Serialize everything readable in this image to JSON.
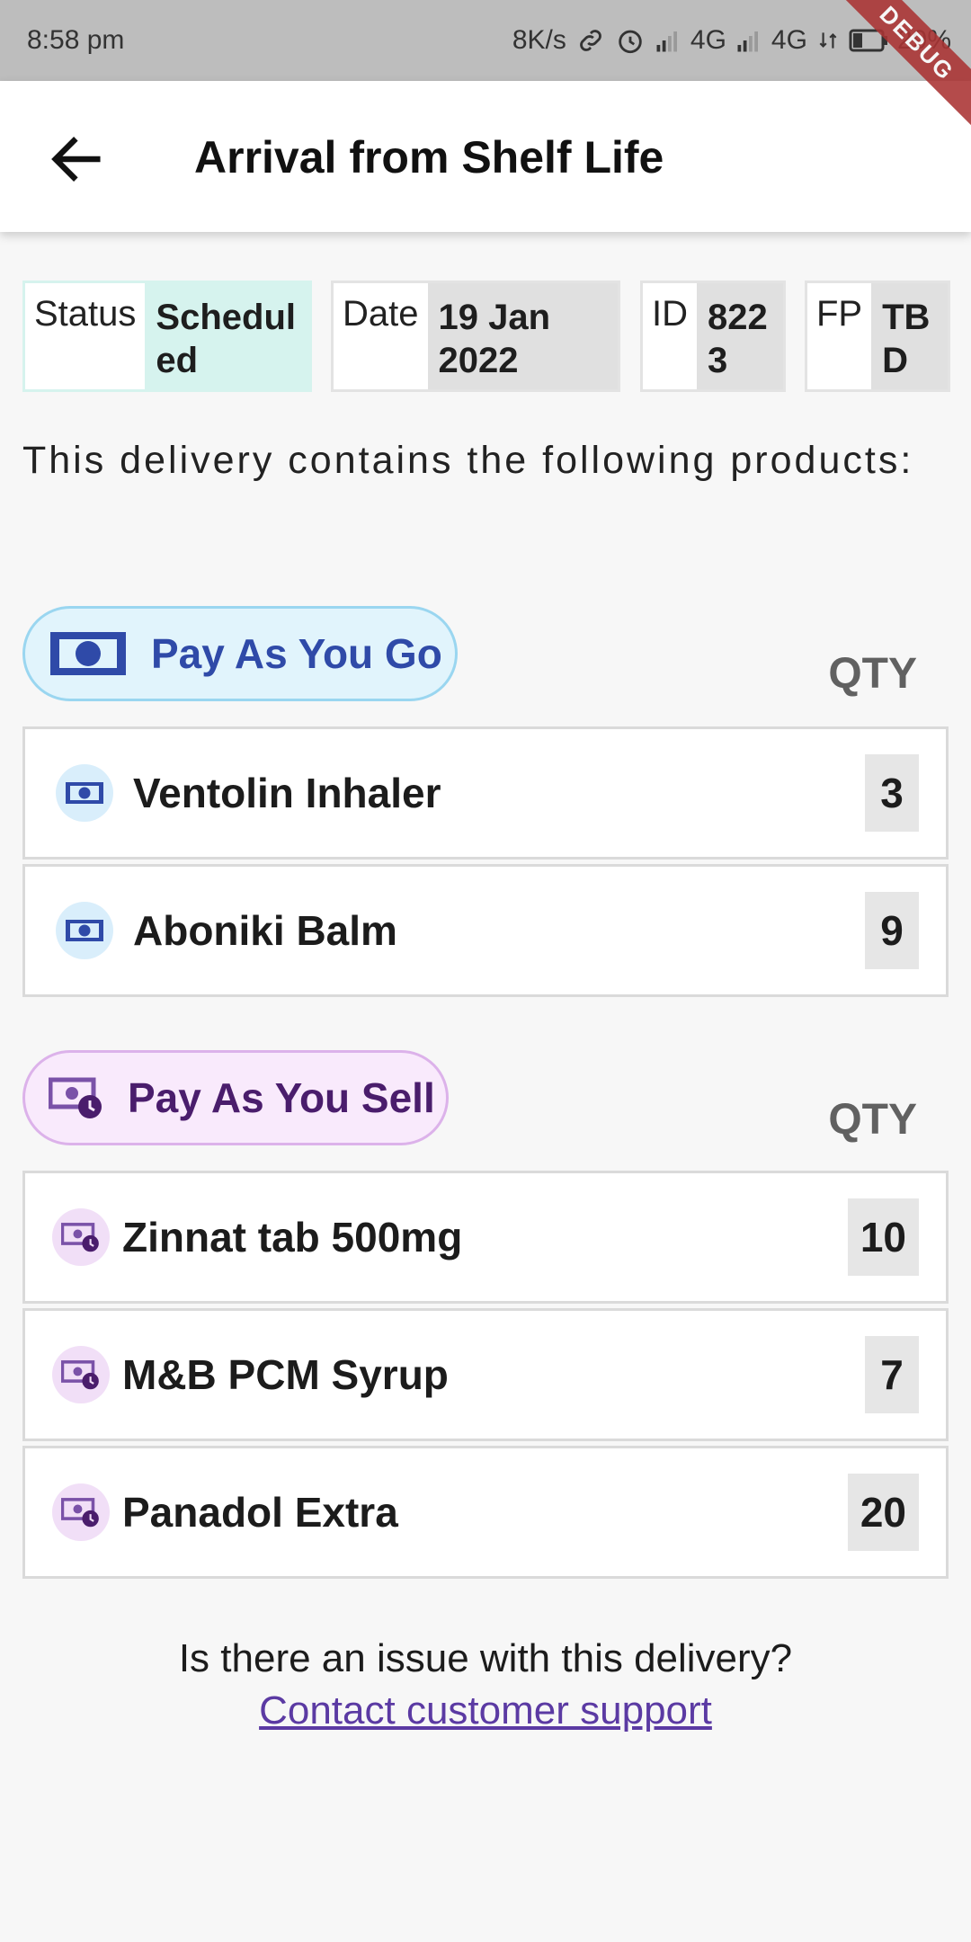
{
  "status_bar": {
    "time": "8:58 pm",
    "net_speed": "8K/s",
    "network_1": "4G",
    "network_2": "4G",
    "battery": "29%",
    "debug_label": "DEBUG"
  },
  "app_bar": {
    "title": "Arrival from Shelf Life"
  },
  "info": {
    "status_key": "Status",
    "status_value": "Scheduled",
    "date_key": "Date",
    "date_value": "19 Jan 2022",
    "id_key": "ID",
    "id_value": "8223",
    "fp_key": "FP",
    "fp_value": "TBD"
  },
  "intro_text": "This delivery contains the following products:",
  "sections": [
    {
      "label": "Pay As You Go",
      "qty_header": "QTY",
      "items": [
        {
          "name": "Ventolin Inhaler",
          "qty": "3"
        },
        {
          "name": "Aboniki Balm",
          "qty": "9"
        }
      ]
    },
    {
      "label": "Pay As You Sell",
      "qty_header": "QTY",
      "items": [
        {
          "name": "Zinnat tab 500mg",
          "qty": "10"
        },
        {
          "name": "M&B PCM Syrup",
          "qty": "7"
        },
        {
          "name": "Panadol Extra",
          "qty": "20"
        }
      ]
    }
  ],
  "footer": {
    "question": "Is there an issue with this delivery?",
    "link": "Contact customer support"
  },
  "colors": {
    "payg_accent": "#2f4aa8",
    "pays_accent": "#4a1d6c",
    "status_bg": "#d6f3ee",
    "link": "#5b3aa3"
  }
}
